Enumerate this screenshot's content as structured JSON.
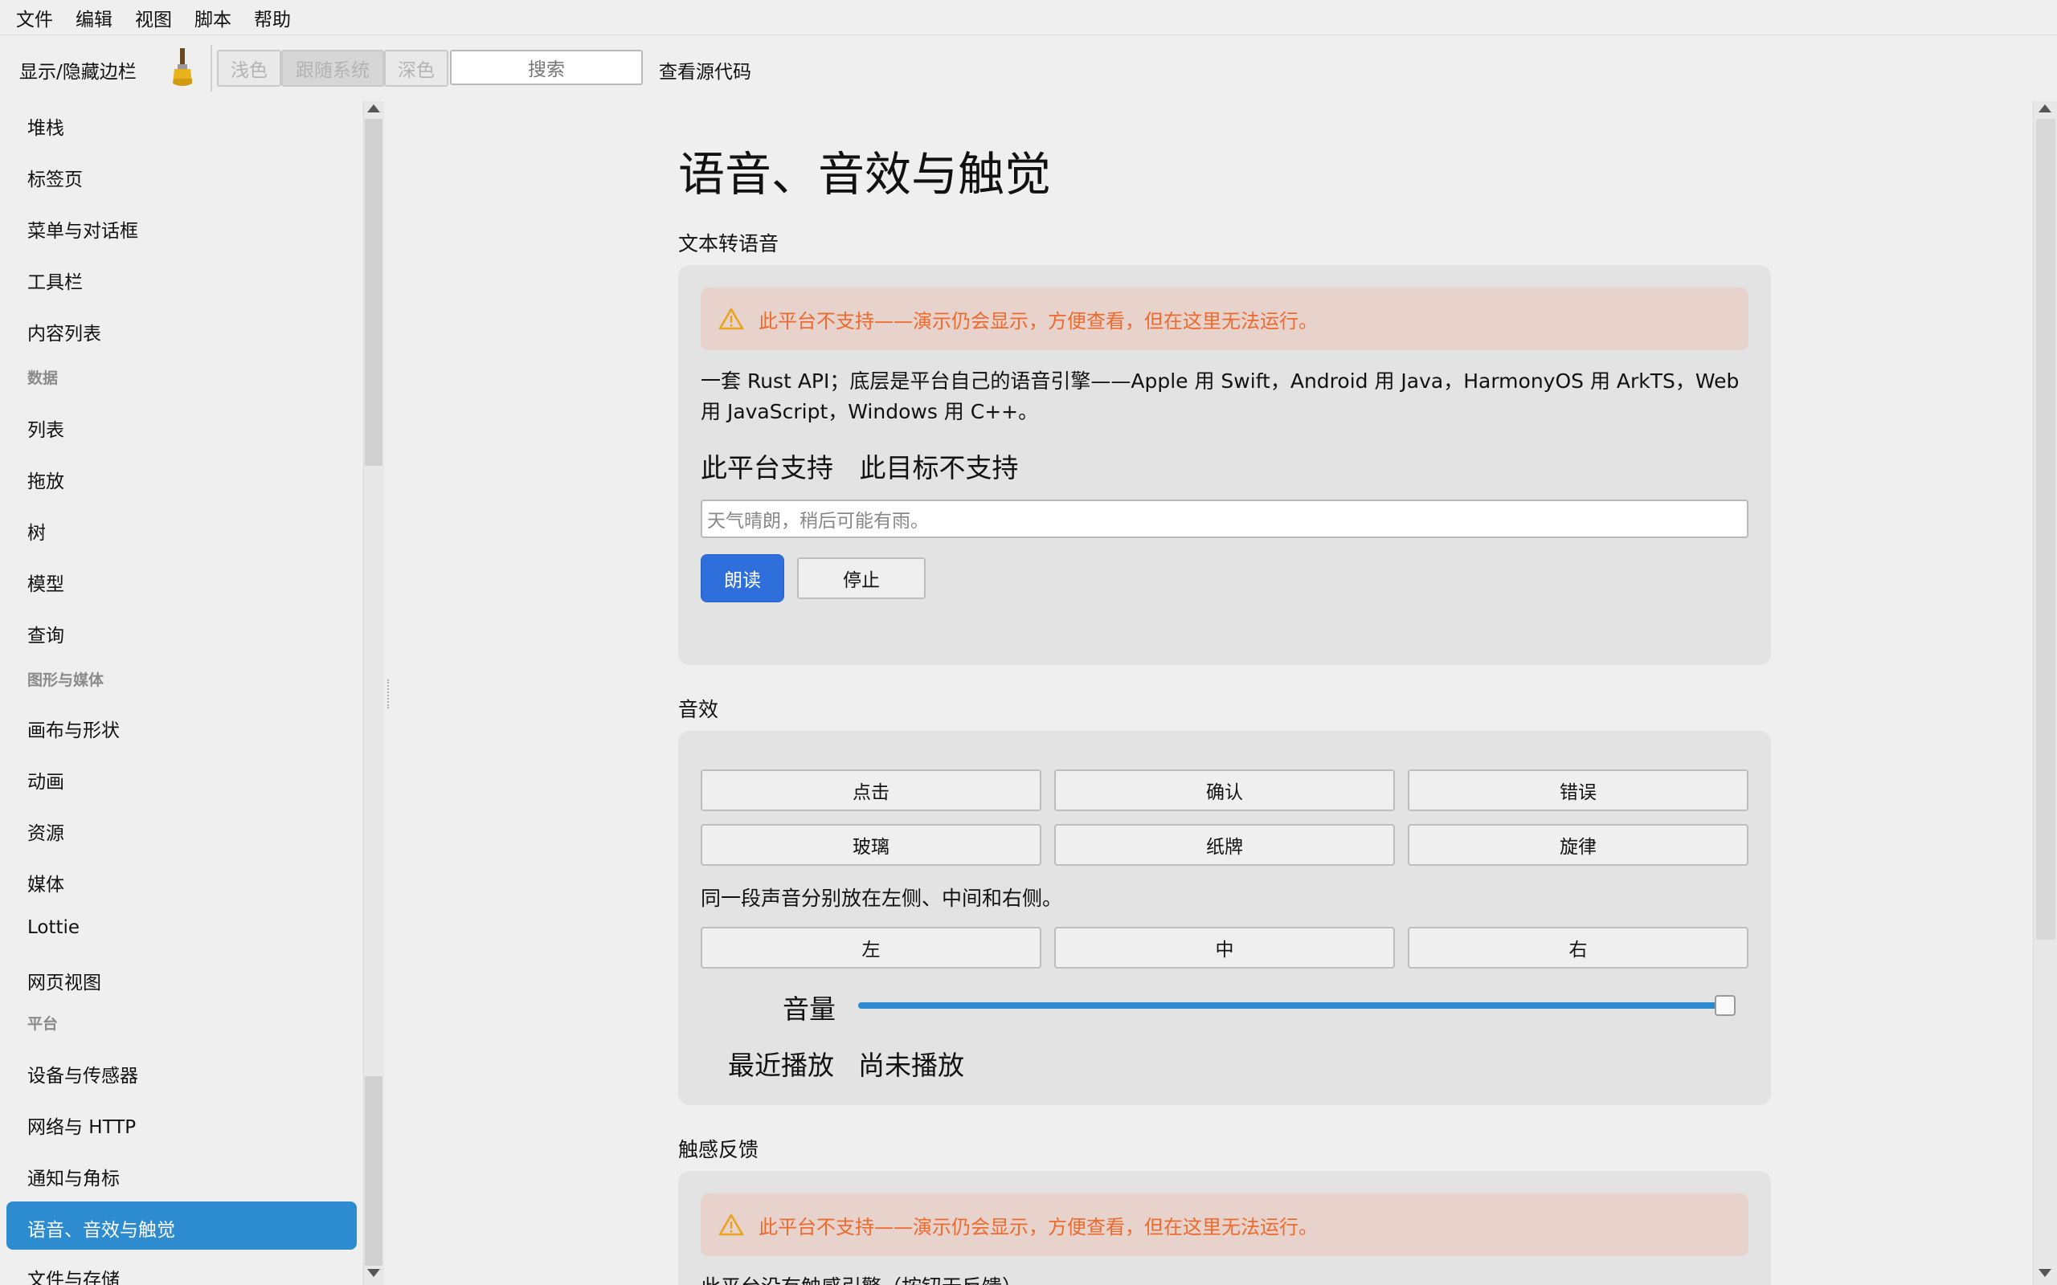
{
  "menubar": {
    "items": [
      "文件",
      "编辑",
      "视图",
      "脚本",
      "帮助"
    ]
  },
  "toolbar": {
    "toggle_sidebar": "显示/隐藏边栏",
    "theme_light": "浅色",
    "theme_system": "跟随系统",
    "theme_dark": "深色",
    "search_placeholder": "搜索",
    "view_source": "查看源代码"
  },
  "sidebar": {
    "items": [
      {
        "type": "item",
        "label": "堆栈"
      },
      {
        "type": "item",
        "label": "标签页"
      },
      {
        "type": "item",
        "label": "菜单与对话框"
      },
      {
        "type": "item",
        "label": "工具栏"
      },
      {
        "type": "item",
        "label": "内容列表"
      },
      {
        "type": "header",
        "label": "数据"
      },
      {
        "type": "item",
        "label": "列表"
      },
      {
        "type": "item",
        "label": "拖放"
      },
      {
        "type": "item",
        "label": "树"
      },
      {
        "type": "item",
        "label": "模型"
      },
      {
        "type": "item",
        "label": "查询"
      },
      {
        "type": "header",
        "label": "图形与媒体"
      },
      {
        "type": "item",
        "label": "画布与形状"
      },
      {
        "type": "item",
        "label": "动画"
      },
      {
        "type": "item",
        "label": "资源"
      },
      {
        "type": "item",
        "label": "媒体"
      },
      {
        "type": "item",
        "label": "Lottie"
      },
      {
        "type": "item",
        "label": "网页视图"
      },
      {
        "type": "header",
        "label": "平台"
      },
      {
        "type": "item",
        "label": "设备与传感器"
      },
      {
        "type": "item",
        "label": "网络与 HTTP"
      },
      {
        "type": "item",
        "label": "通知与角标"
      },
      {
        "type": "selected",
        "label": "语音、音效与触觉"
      },
      {
        "type": "item",
        "label": "文件与存储"
      }
    ]
  },
  "main": {
    "title": "语音、音效与触觉",
    "tts": {
      "section_title": "文本转语音",
      "warning": "此平台不支持——演示仍会显示，方便查看，但在这里无法运行。",
      "description": "一套 Rust API；底层是平台自己的语音引擎——Apple 用 Swift，Android 用 Java，HarmonyOS 用 ArkTS，Web 用 JavaScript，Windows 用 C++。",
      "status_platform": "此平台支持",
      "status_target": "此目标不支持",
      "input_placeholder": "天气晴朗，稍后可能有雨。",
      "speak_button": "朗读",
      "stop_button": "停止"
    },
    "sfx": {
      "section_title": "音效",
      "buttons": [
        "点击",
        "确认",
        "错误",
        "玻璃",
        "纸牌",
        "旋律"
      ],
      "pan_description": "同一段声音分别放在左侧、中间和右侧。",
      "pan_buttons": [
        "左",
        "中",
        "右"
      ],
      "volume_label": "音量",
      "volume_value": 1.0,
      "last_played_label": "最近播放",
      "last_played_value": "尚未播放"
    },
    "haptics": {
      "section_title": "触感反馈",
      "warning": "此平台不支持——演示仍会显示，方便查看，但在这里无法运行。",
      "description": "此平台没有触感引擎（按钮无反馈）。"
    }
  },
  "colors": {
    "accent": "#2d8bd0",
    "primary_button": "#2f6fdb",
    "warning_text": "#ee6a2c",
    "warning_bg": "#e8d2cc",
    "panel_bg": "#e3e3e3"
  }
}
